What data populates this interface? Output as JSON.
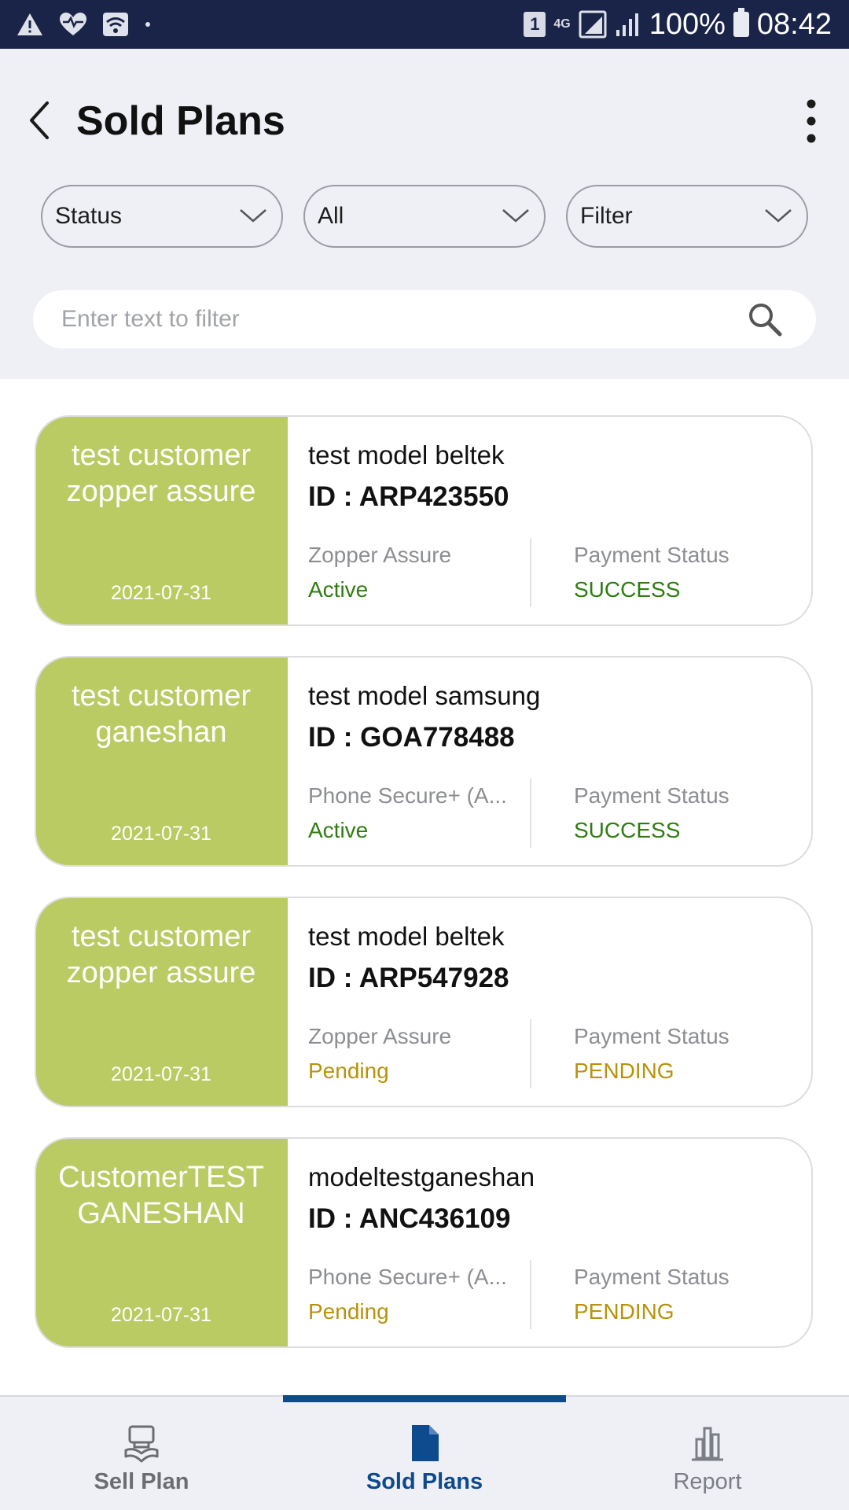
{
  "status_bar": {
    "battery": "100%",
    "time": "08:42",
    "sim_slot": "1",
    "network": "4G"
  },
  "header": {
    "title": "Sold Plans"
  },
  "filters": {
    "status_label": "Status",
    "type_label": "All",
    "filter_label": "Filter",
    "search_placeholder": "Enter text to filter"
  },
  "plans": [
    {
      "customer": "test customer zopper assure",
      "date": "2021-07-31",
      "model": "test model beltek",
      "id": "ID : ARP423550",
      "plan_name": "Zopper Assure",
      "plan_status": "Active",
      "payment_label": "Payment Status",
      "payment_status": "SUCCESS"
    },
    {
      "customer": "test customer ganeshan",
      "date": "2021-07-31",
      "model": "test model samsung",
      "id": "ID : GOA778488",
      "plan_name": "Phone Secure+ (A...",
      "plan_status": "Active",
      "payment_label": "Payment Status",
      "payment_status": "SUCCESS"
    },
    {
      "customer": "test customer zopper assure",
      "date": "2021-07-31",
      "model": "test model beltek",
      "id": "ID : ARP547928",
      "plan_name": "Zopper Assure",
      "plan_status": "Pending",
      "payment_label": "Payment Status",
      "payment_status": "PENDING"
    },
    {
      "customer": "CustomerTEST GANESHAN",
      "date": "2021-07-31",
      "model": "modeltestganeshan",
      "id": "ID : ANC436109",
      "plan_name": "Phone Secure+ (A...",
      "plan_status": "Pending",
      "payment_label": "Payment Status",
      "payment_status": "PENDING"
    }
  ],
  "bottom_nav": {
    "items": [
      {
        "label": "Sell Plan",
        "icon": "sell-plan-icon"
      },
      {
        "label": "Sold Plans",
        "icon": "document-icon",
        "active": true
      },
      {
        "label": "Report",
        "icon": "bar-chart-icon"
      }
    ]
  },
  "colors": {
    "status_bar": "#1a2348",
    "card_accent": "#bacb63",
    "active_green": "#2f7d12",
    "pending_amber": "#b9920a",
    "nav_active": "#0d4a8e"
  }
}
